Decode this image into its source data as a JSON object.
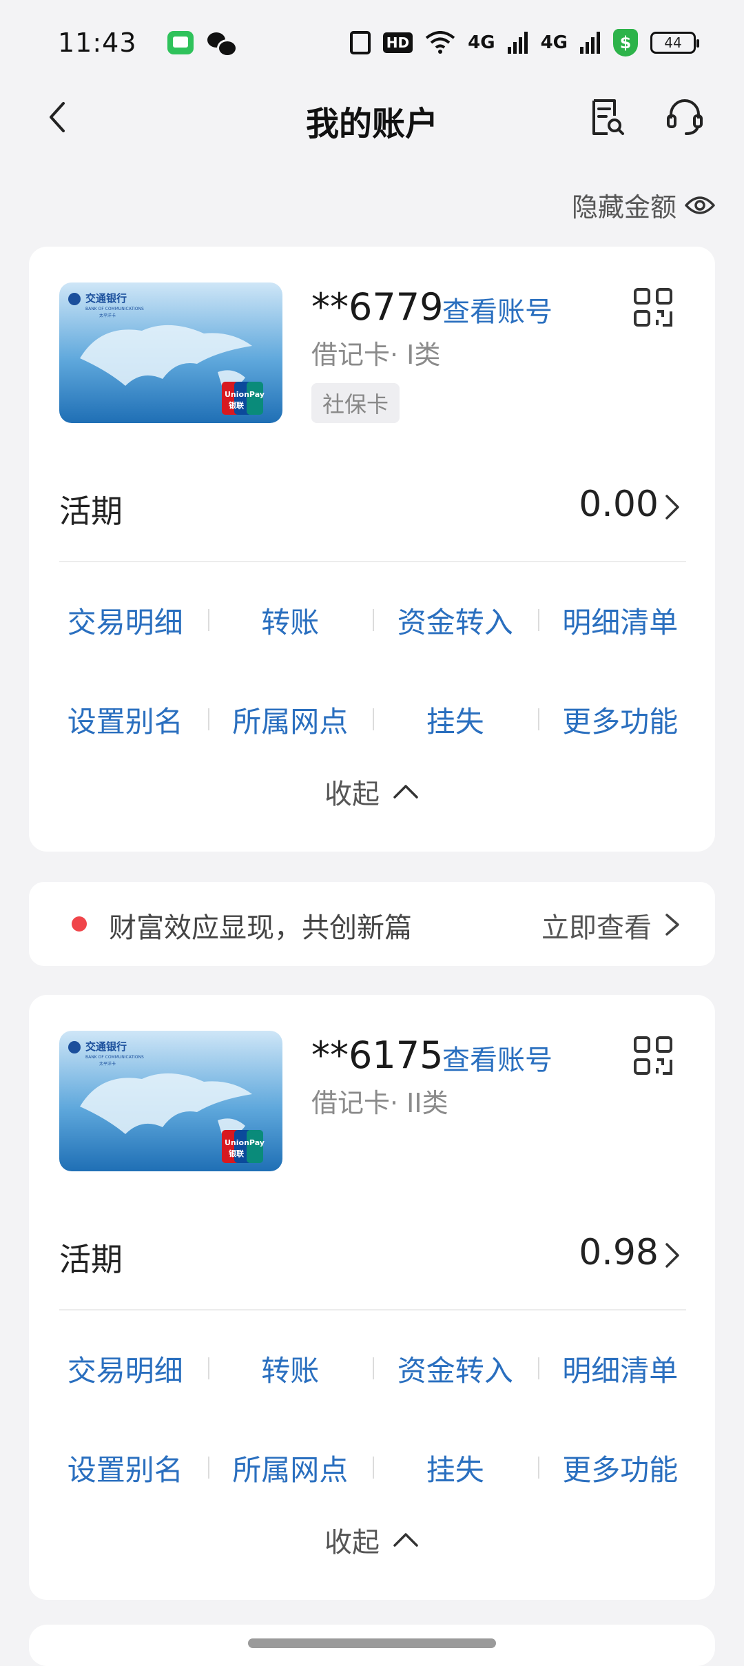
{
  "status_bar": {
    "time": "11:43",
    "hd_label": "HD",
    "net_4g_a": "4G",
    "net_4g_b": "4G",
    "shield_label": "$",
    "battery": "44"
  },
  "nav": {
    "title": "我的账户"
  },
  "hide_amount_label": "隐藏金额",
  "accounts": [
    {
      "bank_name": "交通银行",
      "bank_name_en": "BANK OF COMMUNICATIONS",
      "card_sub_brand": "太平洋卡",
      "number": "**6779",
      "view_number": "查看账号",
      "card_type": "借记卡· I类",
      "tag": "社保卡",
      "balance_label": "活期",
      "balance": "0.00",
      "actions_row1": [
        "交易明细",
        "转账",
        "资金转入",
        "明细清单"
      ],
      "actions_row2": [
        "设置别名",
        "所属网点",
        "挂失",
        "更多功能"
      ],
      "collapse_label": "收起"
    },
    {
      "bank_name": "交通银行",
      "bank_name_en": "BANK OF COMMUNICATIONS",
      "card_sub_brand": "太平洋卡",
      "number": "**6175",
      "view_number": "查看账号",
      "card_type": "借记卡· II类",
      "balance_label": "活期",
      "balance": "0.98",
      "actions_row1": [
        "交易明细",
        "转账",
        "资金转入",
        "明细清单"
      ],
      "actions_row2": [
        "设置别名",
        "所属网点",
        "挂失",
        "更多功能"
      ],
      "collapse_label": "收起"
    }
  ],
  "promo": {
    "text": "财富效应显现，共创新篇",
    "link": "立即查看"
  },
  "colors": {
    "link_blue": "#2a6fbf",
    "background": "#f3f3f5",
    "promo_dot": "#f0454a"
  },
  "icons": [
    "back-icon",
    "bill-search-icon",
    "customer-service-icon",
    "eye-icon",
    "qr-code-icon",
    "chevron-right-icon",
    "chevron-up-icon"
  ]
}
